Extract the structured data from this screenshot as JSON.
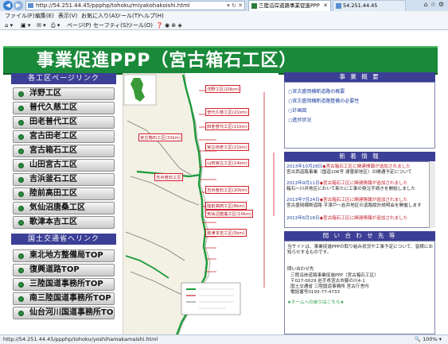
{
  "browser": {
    "url": "http://54.251.44.45/ppphp/tohoku/miyakohakoishi.html",
    "tab_active": "三陸沿岸道路事業促進PPP",
    "tab_other": "54.251.44.45",
    "menu": [
      "ファイル(F)",
      "編集(E)",
      "表示(V)",
      "お気に入り(A)",
      "ツール(T)",
      "ヘルプ(H)"
    ],
    "toolbar": [
      "ページ(P)",
      "セーフティ(S)",
      "ツール(O)"
    ],
    "status_url": "http://54.251.44.45/ppphp/tohoku/yoshihamakamaishi.html",
    "zoom": "100%"
  },
  "page": {
    "title": "事業促進PPP（宮古箱石工区）",
    "sidebar": {
      "section1": "各工区ページリンク",
      "links": [
        "洋野工区",
        "普代久慈工区",
        "田老普代工区",
        "宮古田老工区",
        "宮古箱石工区",
        "山田宮古工区",
        "吉浜釜石工区",
        "陸前高田工区",
        "気仙沼唐桑工区",
        "歌津本吉工区"
      ],
      "section2": "国土交通省へリンク",
      "links2": [
        "東北地方整備局TOP",
        "復興道路TOP",
        "三陸国道事務所TOP",
        "南三陸国道事務所TOP",
        "仙台河川国道事務所TOP"
      ]
    },
    "map": {
      "labels": [
        {
          "name": "洋野工区",
          "dist": "(20km)"
        },
        {
          "name": "普代久慈工区",
          "dist": "(21km)"
        },
        {
          "name": "田老普代工区",
          "dist": "(21km)"
        },
        {
          "name": "宮古箱石工区",
          "dist": "(33km)"
        },
        {
          "name": "宮古田老工区",
          "dist": "(21km)"
        },
        {
          "name": "山田宮古工区",
          "dist": "(14km)"
        },
        {
          "name": "吉浜釜石工区",
          "dist": ""
        },
        {
          "name": "吉浜釜石工区",
          "dist": "(20km)"
        },
        {
          "name": "陸前高田工区",
          "dist": "(8km)"
        },
        {
          "name": "気仙沼唐桑工区",
          "dist": "(10km)"
        },
        {
          "name": "歌津本吉工区",
          "dist": "(5km)"
        }
      ]
    },
    "right": {
      "h1": "事 業 概 要",
      "overview_links": [
        "宮古盛岡横断道路の概要",
        "宮古盛岡横断道路整備の必要性",
        "計画図",
        "進捗状況"
      ],
      "h2": "新 着 情 報",
      "news": [
        {
          "date": "2013年10月28日",
          "title": "◆宮古箱石工区に関連情報が追加されました",
          "body": "宮古西道路事業（国道106号 達曽部地区）の開通予定について"
        },
        {
          "date": "2013年9月11日",
          "title": "◆宮古箱石工区に関連情報が追加されました",
          "body": "箱石～川井地区において新たに工事の発注手続きを開始しました"
        },
        {
          "date": "2013年7月24日",
          "title": "◆宮古箱石工区に関連情報が追加されました",
          "body": "宮古盛岡横断道路 平津戸～岩井地区の道路設計説明会を開催します"
        },
        {
          "date": "2013年6月18日",
          "title": "◆宮古箱石工区に関連情報が追加されました",
          "body": ""
        }
      ],
      "h3": "問 い 合 わ せ 先 等",
      "contact_intro": "当サイトは、事業促進PPPの取り組み状況や工事予定について、皆様にお知らせするものです。",
      "contact_name": "問い合わせ先",
      "contact_lines": [
        "三陸沿岸道路事業促進PPP（宮古箱石工区）",
        "〒027-0029 岩手県宮古市藤の川4-1",
        "国土交通省 三陸国道事務所 宮古庁舎内",
        "電話番号0193-77-4733"
      ],
      "contact_link": "★ホームへの戻りはこちら★"
    }
  }
}
